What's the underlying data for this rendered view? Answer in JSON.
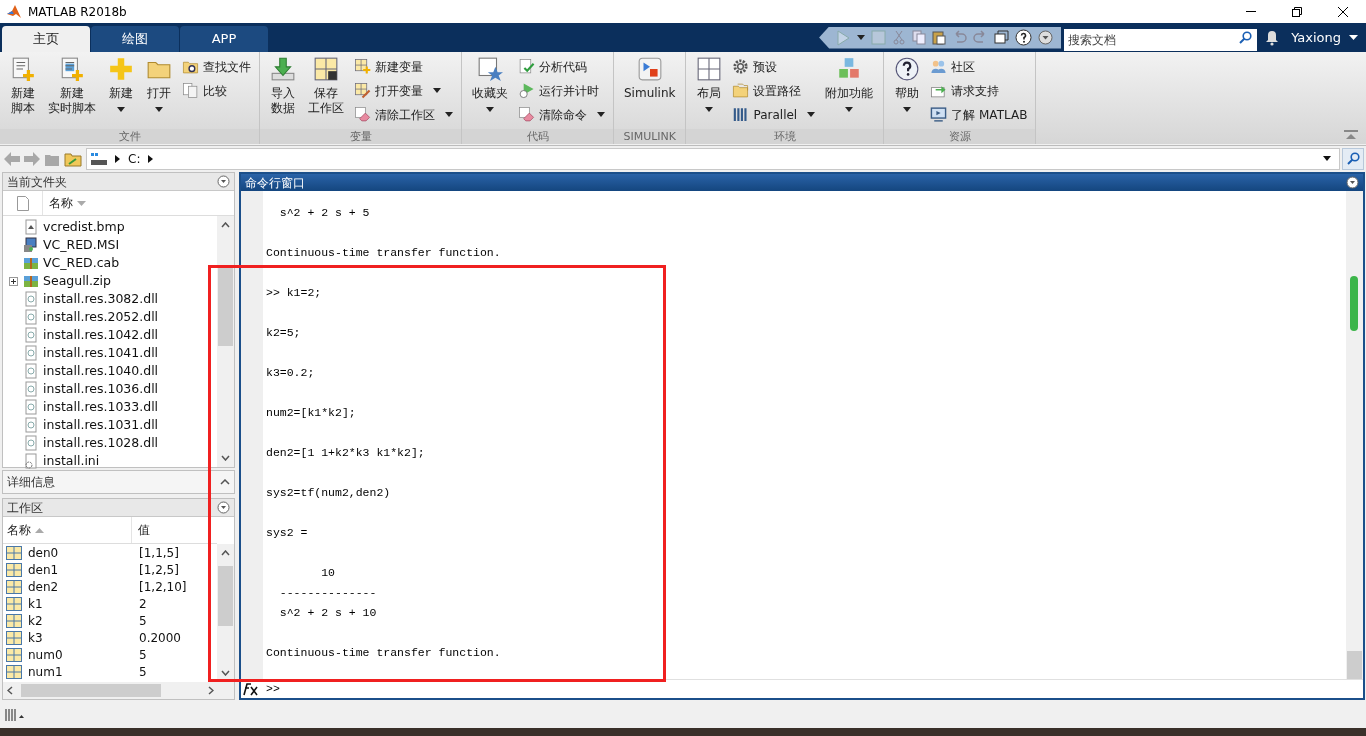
{
  "window": {
    "title": "MATLAB R2018b"
  },
  "tabs": [
    {
      "label": "主页",
      "selected": true
    },
    {
      "label": "绘图",
      "selected": false
    },
    {
      "label": "APP",
      "selected": false
    }
  ],
  "search": {
    "placeholder": "搜索文档"
  },
  "user": {
    "name": "Yaxiong"
  },
  "ribbon": [
    {
      "label": "文件",
      "items": [
        {
          "kind": "large",
          "label": [
            "新建",
            "脚本"
          ],
          "menu": false
        },
        {
          "kind": "large",
          "label": [
            "新建",
            "实时脚本"
          ],
          "menu": false
        },
        {
          "kind": "large",
          "label": [
            "新建"
          ],
          "menu": true
        },
        {
          "kind": "large",
          "label": [
            "打开"
          ],
          "menu": true
        },
        {
          "kind": "stack",
          "items": [
            {
              "label": "查找文件",
              "menu": false
            },
            {
              "label": "比较",
              "menu": false
            }
          ]
        }
      ]
    },
    {
      "label": "变量",
      "items": [
        {
          "kind": "large",
          "label": [
            "导入",
            "数据"
          ],
          "menu": false
        },
        {
          "kind": "large",
          "label": [
            "保存",
            "工作区"
          ],
          "menu": false
        },
        {
          "kind": "stack",
          "items": [
            {
              "label": "新建变量",
              "menu": false
            },
            {
              "label": "打开变量",
              "menu": true
            },
            {
              "label": "清除工作区",
              "menu": true
            }
          ]
        }
      ]
    },
    {
      "label": "代码",
      "items": [
        {
          "kind": "large",
          "label": [
            "收藏夹"
          ],
          "menu": true
        },
        {
          "kind": "stack",
          "items": [
            {
              "label": "分析代码",
              "menu": false
            },
            {
              "label": "运行并计时",
              "menu": false
            },
            {
              "label": "清除命令",
              "menu": true
            }
          ]
        }
      ]
    },
    {
      "label": "SIMULINK",
      "items": [
        {
          "kind": "large",
          "label": [
            "Simulink"
          ],
          "menu": false
        }
      ]
    },
    {
      "label": "环境",
      "items": [
        {
          "kind": "large",
          "label": [
            "布局"
          ],
          "menu": true
        },
        {
          "kind": "stack",
          "items": [
            {
              "label": "预设",
              "menu": false
            },
            {
              "label": "设置路径",
              "menu": false
            },
            {
              "label": "Parallel",
              "menu": true
            }
          ]
        },
        {
          "kind": "large",
          "label": [
            "附加功能"
          ],
          "menu": true
        }
      ]
    },
    {
      "label": "资源",
      "items": [
        {
          "kind": "large",
          "label": [
            "帮助"
          ],
          "menu": true
        },
        {
          "kind": "stack",
          "items": [
            {
              "label": "社区",
              "menu": false
            },
            {
              "label": "请求支持",
              "menu": false
            },
            {
              "label": "了解 MATLAB",
              "menu": false
            }
          ]
        }
      ]
    }
  ],
  "address": {
    "path": [
      "C:"
    ]
  },
  "current_folder": {
    "title": "当前文件夹",
    "column": "名称",
    "files": [
      {
        "name": "vcredist.bmp",
        "kind": "image",
        "expandable": false
      },
      {
        "name": "VC_RED.MSI",
        "kind": "installer",
        "expandable": false
      },
      {
        "name": "VC_RED.cab",
        "kind": "archive",
        "expandable": false
      },
      {
        "name": "Seagull.zip",
        "kind": "archive",
        "expandable": true
      },
      {
        "name": "install.res.3082.dll",
        "kind": "library",
        "expandable": false
      },
      {
        "name": "install.res.2052.dll",
        "kind": "library",
        "expandable": false
      },
      {
        "name": "install.res.1042.dll",
        "kind": "library",
        "expandable": false
      },
      {
        "name": "install.res.1041.dll",
        "kind": "library",
        "expandable": false
      },
      {
        "name": "install.res.1040.dll",
        "kind": "library",
        "expandable": false
      },
      {
        "name": "install.res.1036.dll",
        "kind": "library",
        "expandable": false
      },
      {
        "name": "install.res.1033.dll",
        "kind": "library",
        "expandable": false
      },
      {
        "name": "install.res.1031.dll",
        "kind": "library",
        "expandable": false
      },
      {
        "name": "install.res.1028.dll",
        "kind": "library",
        "expandable": false
      },
      {
        "name": "install.ini",
        "kind": "config",
        "expandable": false
      }
    ]
  },
  "details": {
    "title": "详细信息"
  },
  "workspace": {
    "title": "工作区",
    "columns": [
      "名称",
      "值"
    ],
    "rows": [
      {
        "name": "den0",
        "value": "[1,1,5]"
      },
      {
        "name": "den1",
        "value": "[1,2,5]"
      },
      {
        "name": "den2",
        "value": "[1,2,10]"
      },
      {
        "name": "k1",
        "value": "2"
      },
      {
        "name": "k2",
        "value": "5"
      },
      {
        "name": "k3",
        "value": "0.2000"
      },
      {
        "name": "num0",
        "value": "5"
      },
      {
        "name": "num1",
        "value": "5"
      }
    ]
  },
  "command_window": {
    "title": "命令行窗口",
    "blocks": [
      [
        "  s^2 + 2 s + 5"
      ],
      [
        "Continuous-time transfer function."
      ],
      [
        ">> k1=2;"
      ],
      [
        "k2=5;"
      ],
      [
        "k3=0.2;"
      ],
      [
        "num2=[k1*k2];"
      ],
      [
        "den2=[1 1+k2*k3 k1*k2];"
      ],
      [
        "sys2=tf(num2,den2)"
      ],
      [
        "sys2 ="
      ],
      [
        "        10",
        "  --------------",
        "  s^2 + 2 s + 10"
      ],
      [
        "Continuous-time transfer function."
      ]
    ],
    "prompt": ">>"
  }
}
